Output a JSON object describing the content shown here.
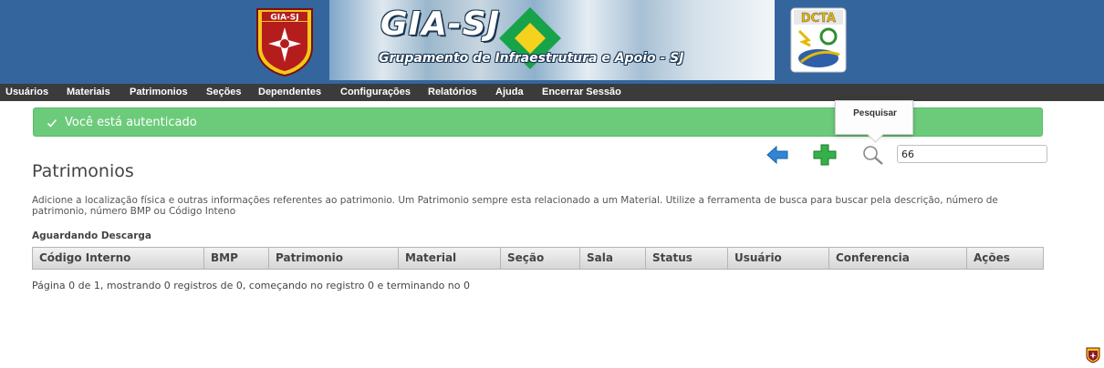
{
  "header": {
    "left_emblem_text": "GIA-SJ",
    "title": "GIA-SJ",
    "subtitle": "Grupamento de Infraestrutura e Apoio - SJ",
    "right_emblem_text": "DCTA",
    "background_color": "#35659d"
  },
  "menu": {
    "items": [
      "Usuários",
      "Materiais",
      "Patrimonios",
      "Seções",
      "Dependentes",
      "Configurações",
      "Relatórios",
      "Ajuda",
      "Encerrar Sessão"
    ],
    "background_color": "#3b3b3b"
  },
  "alert": {
    "message": "Você está autenticado",
    "color": "#6ccb7a"
  },
  "toolbar": {
    "back_icon": "arrow-left-icon",
    "add_icon": "plus-icon",
    "search_icon": "magnifier-icon",
    "search_tooltip": "Pesquisar",
    "search_value": "66"
  },
  "page": {
    "title": "Patrimonios",
    "description": "Adicione a localização física e outras informações referentes ao patrimonio. Um Patrimonio sempre esta relacionado a um Material. Utilize a ferramenta de busca para buscar pela descrição, número de patrimonio, número BMP ou Código Inteno",
    "section_label": "Aguardando Descarga"
  },
  "table": {
    "columns": [
      "Código Interno",
      "BMP",
      "Patrimonio",
      "Material",
      "Seção",
      "Sala",
      "Status",
      "Usuário",
      "Conferencia",
      "Ações"
    ],
    "rows": []
  },
  "pager": {
    "text": "Página 0 de 1, mostrando 0 registros de 0, começando no registro 0 e terminando no 0"
  }
}
